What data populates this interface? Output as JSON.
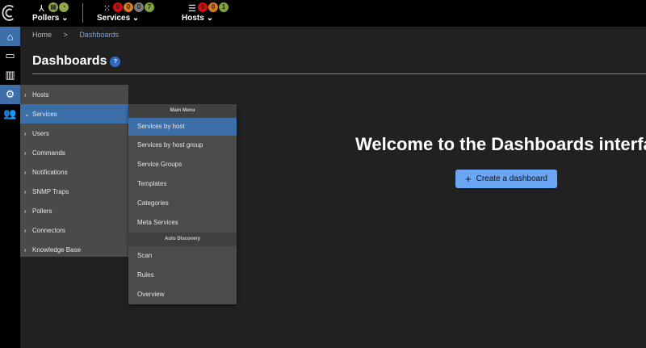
{
  "topbar": {
    "pollers": {
      "label": "Pollers",
      "icon": "pollers-network-icon",
      "badges": [
        {
          "color": "#8ea84a",
          "icon": "database-icon"
        },
        {
          "color": "#8ea84a",
          "icon": "latency-gauge-icon"
        }
      ]
    },
    "services": {
      "label": "Services",
      "icon": "services-grid-icon",
      "badges": [
        {
          "value": "0",
          "color": "#d60d0d"
        },
        {
          "value": "0",
          "color": "#d87a1a"
        },
        {
          "value": "0",
          "color": "#7a7a7a"
        },
        {
          "value": "7",
          "color": "#82a33a"
        }
      ]
    },
    "hosts": {
      "label": "Hosts",
      "icon": "server-icon",
      "badges": [
        {
          "value": "0",
          "color": "#d60d0d"
        },
        {
          "value": "0",
          "color": "#d87a1a"
        },
        {
          "value": "1",
          "color": "#82a33a"
        }
      ]
    }
  },
  "sidebar": [
    {
      "icon": "home-icon",
      "active": true
    },
    {
      "icon": "monitoring-icon"
    },
    {
      "icon": "reporting-chart-icon"
    },
    {
      "icon": "configuration-gear-icon",
      "active": true
    },
    {
      "icon": "administration-users-icon"
    }
  ],
  "breadcrumb": {
    "home": "Home",
    "sep": ">",
    "current": "Dashboards"
  },
  "page": {
    "title": "Dashboards",
    "help": "?",
    "welcome": "Welcome to the Dashboards interface",
    "create_label": "Create a dashboard",
    "create_icon": "+"
  },
  "menu": {
    "items": [
      "Hosts",
      "Services",
      "Users",
      "Commands",
      "Notifications",
      "SNMP Traps",
      "Pollers",
      "Connectors",
      "Knowledge Base"
    ],
    "active": "Services"
  },
  "submenu": {
    "main_header": "Main Menu",
    "main_items": [
      "Services by host",
      "Services by host group",
      "Service Groups",
      "Templates",
      "Categories",
      "Meta Services"
    ],
    "auto_header": "Auto Discovery",
    "auto_items": [
      "Scan",
      "Rules",
      "Overview"
    ],
    "active": "Services by host"
  },
  "colors": {
    "accent": "#3c6ea8",
    "button": "#6aa6f2",
    "link": "#6fa1e6"
  }
}
